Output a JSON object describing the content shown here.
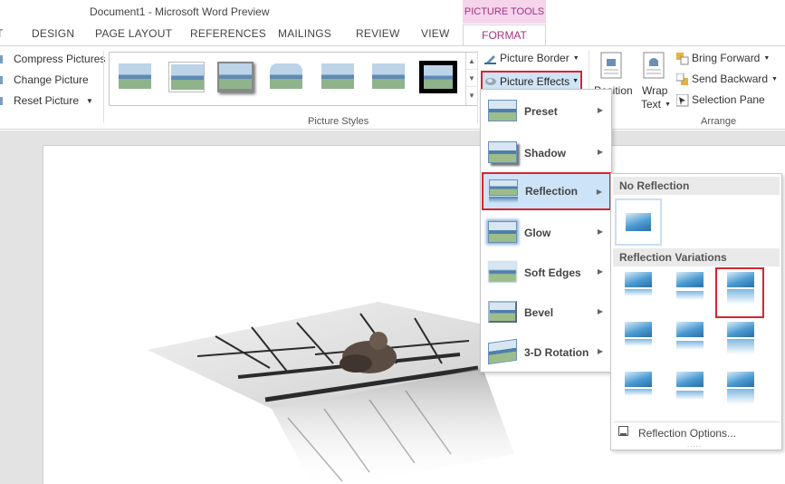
{
  "window": {
    "title": "Document1 - Microsoft Word Preview"
  },
  "context_tab": {
    "header": "PICTURE TOOLS",
    "tab": "FORMAT"
  },
  "tabs": [
    {
      "label": "T"
    },
    {
      "label": "DESIGN"
    },
    {
      "label": "PAGE LAYOUT"
    },
    {
      "label": "REFERENCES"
    },
    {
      "label": "MAILINGS"
    },
    {
      "label": "REVIEW"
    },
    {
      "label": "VIEW"
    }
  ],
  "adjust": {
    "compress": "Compress Pictures",
    "change": "Change Picture",
    "reset": "Reset Picture"
  },
  "picture_styles": {
    "label": "Picture Styles"
  },
  "format_buttons": {
    "border": "Picture Border",
    "effects": "Picture Effects"
  },
  "arrange": {
    "position": "Position",
    "wrap_line1": "Wrap",
    "wrap_line2": "Text",
    "bring_forward": "Bring Forward",
    "send_backward": "Send Backward",
    "selection_pane": "Selection Pane",
    "label": "Arrange"
  },
  "effects_menu": {
    "items": [
      {
        "label": "Preset"
      },
      {
        "label": "Shadow"
      },
      {
        "label": "Reflection"
      },
      {
        "label": "Glow"
      },
      {
        "label": "Soft Edges"
      },
      {
        "label": "Bevel"
      },
      {
        "label": "3-D Rotation"
      }
    ]
  },
  "reflection_menu": {
    "no_reflection_header": "No Reflection",
    "variations_header": "Reflection Variations",
    "options": "Reflection Options...",
    "grip": "....."
  },
  "colors": {
    "accent_pink": "#a23381",
    "highlight_red": "#d9242f",
    "hover_blue": "#cde3f8"
  }
}
